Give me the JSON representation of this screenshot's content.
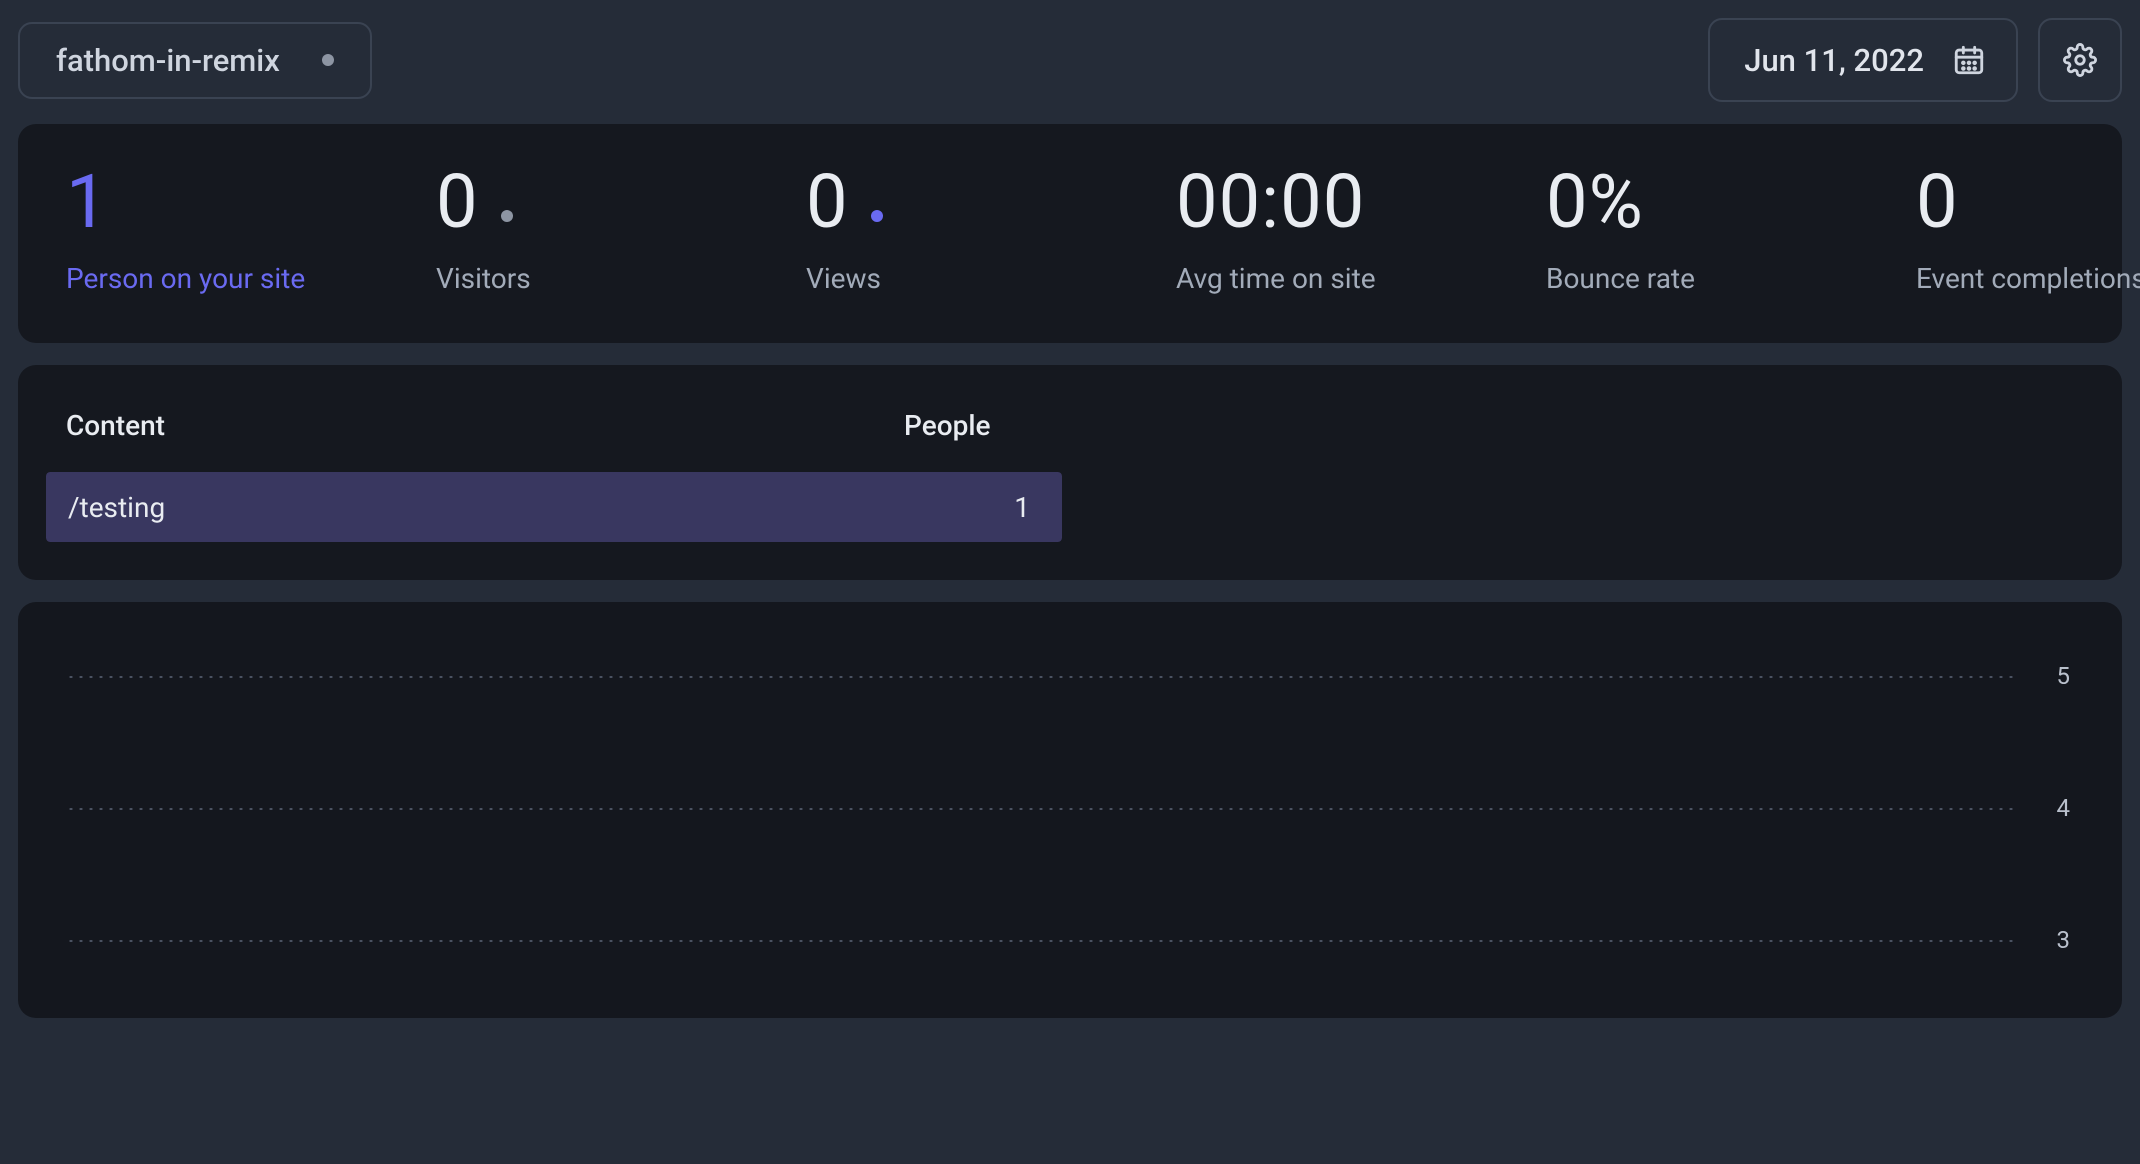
{
  "header": {
    "site_name": "fathom-in-remix",
    "date_label": "Jun 11, 2022"
  },
  "stats": {
    "person_on_site": {
      "value": "1",
      "label": "Person on your site"
    },
    "visitors": {
      "value": "0",
      "label": "Visitors"
    },
    "views": {
      "value": "0",
      "label": "Views"
    },
    "avg_time": {
      "value": "00:00",
      "label": "Avg time on site"
    },
    "bounce_rate": {
      "value": "0%",
      "label": "Bounce rate"
    },
    "event_completions": {
      "value": "0",
      "label": "Event completions"
    }
  },
  "content_table": {
    "col_content": "Content",
    "col_people": "People",
    "rows": [
      {
        "path": "/testing",
        "people": "1",
        "bar_pct": 100
      }
    ]
  },
  "chart_data": {
    "type": "bar",
    "title": "",
    "xlabel": "",
    "ylabel": "",
    "ylim": [
      0,
      5
    ],
    "y_ticks": [
      5,
      4,
      3
    ],
    "categories": [],
    "values": []
  }
}
